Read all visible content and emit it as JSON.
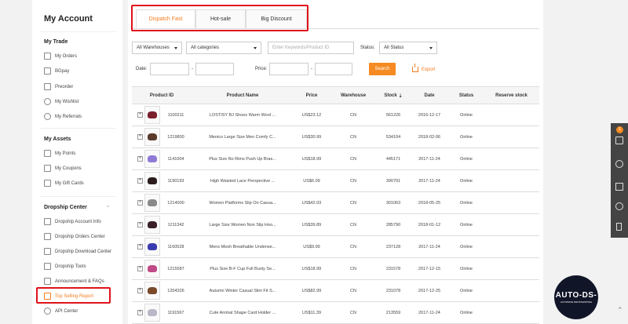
{
  "sidebar": {
    "title": "My Account",
    "sections": [
      {
        "title": "My Trade",
        "items": [
          {
            "label": "My Orders",
            "icon": "orders-icon"
          },
          {
            "label": "BGpay",
            "icon": "wallet-icon"
          },
          {
            "label": "Preorder",
            "icon": "preorder-icon"
          },
          {
            "label": "My Wishlist",
            "icon": "heart-icon"
          },
          {
            "label": "My Referrals",
            "icon": "referral-icon"
          }
        ]
      },
      {
        "title": "My Assets",
        "items": [
          {
            "label": "My Points",
            "icon": "points-icon"
          },
          {
            "label": "My Coupons",
            "icon": "coupon-icon"
          },
          {
            "label": "My Gift Cards",
            "icon": "gift-card-icon"
          }
        ]
      },
      {
        "title": "Dropship Center",
        "items": [
          {
            "label": "Dropship Account Info",
            "icon": "account-info-icon"
          },
          {
            "label": "Dropship Orders Center",
            "icon": "orders-center-icon"
          },
          {
            "label": "Dropship Download Center",
            "icon": "download-icon"
          },
          {
            "label": "Dropship Tools",
            "icon": "tools-icon"
          },
          {
            "label": "Announcement & FAQs",
            "icon": "announcement-icon"
          },
          {
            "label": "Top Selling Report",
            "icon": "bookmark-icon"
          },
          {
            "label": "API Center",
            "icon": "api-icon"
          }
        ]
      }
    ],
    "dropship_chevron": "^"
  },
  "tabs": [
    "Dispatch Fast",
    "Hot-sale",
    "Big Discount"
  ],
  "filters": {
    "warehouses": "All Warehouses",
    "categories": "All categories",
    "keyword_placeholder": "Enter Keywords/Product ID",
    "status_label": "Status:",
    "status_value": "All Status",
    "date_label": "Date:",
    "price_label": "Price:",
    "dash": "-",
    "search_button": "Search",
    "export_button": "Export"
  },
  "table": {
    "headers": [
      "Product ID",
      "Product Name",
      "Price",
      "Warehouse",
      "Stock",
      "Date",
      "Status",
      "Reserve stock"
    ],
    "rows": [
      {
        "id": "1100211",
        "name": "LOSTISY BJ Shoes Warm Wool ...",
        "price": "US$23.12",
        "warehouse": "CN",
        "stock": "561226",
        "date": "2016-12-17",
        "status": "Online",
        "color": "#7a1f2b"
      },
      {
        "id": "1219800",
        "name": "Menico Large Size Men Comfy C...",
        "price": "US$30.99",
        "warehouse": "CN",
        "stock": "534104",
        "date": "2018-02-06",
        "status": "Online",
        "color": "#5a3a2a"
      },
      {
        "id": "1141004",
        "name": "Plus Size No Rims Push Up Bras...",
        "price": "US$18.99",
        "warehouse": "CN",
        "stock": "445171",
        "date": "2017-11-24",
        "status": "Online",
        "color": "#8f7bd6"
      },
      {
        "id": "1190193",
        "name": "High Waisted Lace Perspective ...",
        "price": "US$6.09",
        "warehouse": "CN",
        "stock": "390791",
        "date": "2017-11-24",
        "status": "Online",
        "color": "#2a1c1c"
      },
      {
        "id": "1214000",
        "name": "Women Platforms Slip On Casua...",
        "price": "US$42.03",
        "warehouse": "CN",
        "stock": "301063",
        "date": "2018-05-25",
        "status": "Online",
        "color": "#8a8a8a"
      },
      {
        "id": "1211342",
        "name": "Large Size Women Non Slip Hoo...",
        "price": "US$39.89",
        "warehouse": "CN",
        "stock": "285790",
        "date": "2018-01-12",
        "status": "Online",
        "color": "#3a1f2a"
      },
      {
        "id": "1160528",
        "name": "Mens Mesh Breathable Underwe...",
        "price": "US$9.99",
        "warehouse": "CN",
        "stock": "237128",
        "date": "2017-11-24",
        "status": "Online",
        "color": "#3b3bb0"
      },
      {
        "id": "1215587",
        "name": "Plus Size B-F Cup Full Busty Se...",
        "price": "US$18.99",
        "warehouse": "CN",
        "stock": "231578",
        "date": "2017-12-15",
        "status": "Online",
        "color": "#c04a86"
      },
      {
        "id": "1204326",
        "name": "Autumn Winter Casual Slim Fit S...",
        "price": "US$82.99",
        "warehouse": "CN",
        "stock": "231078",
        "date": "2017-12-25",
        "status": "Online",
        "color": "#7a4a2a"
      },
      {
        "id": "1191567",
        "name": "Cute Animal Shape Card Holder ...",
        "price": "US$11.39",
        "warehouse": "CN",
        "stock": "213559",
        "date": "2017-11-24",
        "status": "Online",
        "color": "#b8b8c8"
      }
    ]
  },
  "float_bar": {
    "cart_count": "1"
  },
  "watermark": {
    "title": "AUTO-DS-",
    "subtitle": "AUTOMATE DROPSHIPPING"
  },
  "colors": {
    "accent": "#f57c1f",
    "highlight_box": "#e0121b",
    "search_button": "#f58b22"
  }
}
